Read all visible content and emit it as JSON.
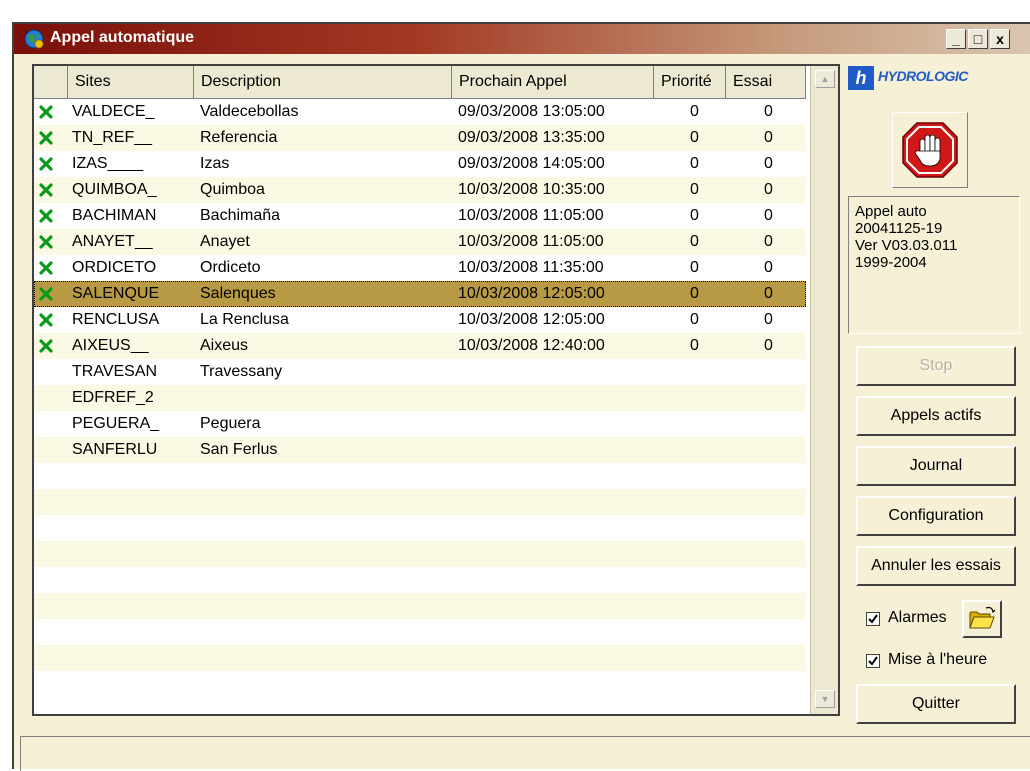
{
  "window": {
    "title": "Appel automatique",
    "minimize_label": "_",
    "maximize_label": "□",
    "close_label": "x"
  },
  "grid": {
    "columns": [
      "Sites",
      "Description",
      "Prochain Appel",
      "Priorité",
      "Essai"
    ],
    "rows": [
      {
        "site": "VALDECE_",
        "description": "Valdecebollas",
        "next_call": "09/03/2008 13:05:00",
        "priority": "0",
        "attempt": "0",
        "status_icon": "green-x-icon"
      },
      {
        "site": "TN_REF__",
        "description": "Referencia",
        "next_call": "09/03/2008 13:35:00",
        "priority": "0",
        "attempt": "0",
        "status_icon": "green-x-icon"
      },
      {
        "site": "IZAS____",
        "description": "Izas",
        "next_call": "09/03/2008 14:05:00",
        "priority": "0",
        "attempt": "0",
        "status_icon": "green-x-icon"
      },
      {
        "site": "QUIMBOA_",
        "description": "Quimboa",
        "next_call": "10/03/2008 10:35:00",
        "priority": "0",
        "attempt": "0",
        "status_icon": "green-x-icon"
      },
      {
        "site": "BACHIMAN",
        "description": "Bachimaña",
        "next_call": "10/03/2008 11:05:00",
        "priority": "0",
        "attempt": "0",
        "status_icon": "green-x-icon"
      },
      {
        "site": "ANAYET__",
        "description": "Anayet",
        "next_call": "10/03/2008 11:05:00",
        "priority": "0",
        "attempt": "0",
        "status_icon": "green-x-icon"
      },
      {
        "site": "ORDICETO",
        "description": "Ordiceto",
        "next_call": "10/03/2008 11:35:00",
        "priority": "0",
        "attempt": "0",
        "status_icon": "green-x-icon"
      },
      {
        "site": "SALENQUE",
        "description": "Salenques",
        "next_call": "10/03/2008 12:05:00",
        "priority": "0",
        "attempt": "0",
        "status_icon": "green-x-icon"
      },
      {
        "site": "RENCLUSA",
        "description": "La Renclusa",
        "next_call": "10/03/2008 12:05:00",
        "priority": "0",
        "attempt": "0",
        "status_icon": "green-x-icon"
      },
      {
        "site": "AIXEUS__",
        "description": "Aixeus",
        "next_call": "10/03/2008 12:40:00",
        "priority": "0",
        "attempt": "0",
        "status_icon": "green-x-icon"
      },
      {
        "site": "TRAVESAN",
        "description": "Travessany",
        "next_call": "",
        "priority": "",
        "attempt": "",
        "status_icon": ""
      },
      {
        "site": "EDFREF_2",
        "description": "",
        "next_call": "",
        "priority": "",
        "attempt": "",
        "status_icon": ""
      },
      {
        "site": "PEGUERA_",
        "description": "Peguera",
        "next_call": "",
        "priority": "",
        "attempt": "",
        "status_icon": ""
      },
      {
        "site": "SANFERLU",
        "description": "San Ferlus",
        "next_call": "",
        "priority": "",
        "attempt": "",
        "status_icon": ""
      }
    ],
    "selected_row": 7
  },
  "sidebar": {
    "logo_mark": "h",
    "logo_text": "HYDROLOGIC",
    "stop_icon": "stop-hand-icon",
    "info_lines": [
      "Appel auto",
      "20041125-19",
      "Ver V03.03.011",
      "1999-2004"
    ],
    "buttons": {
      "stop": "Stop",
      "active_calls": "Appels actifs",
      "journal": "Journal",
      "configuration": "Configuration",
      "cancel_attempts": "Annuler les essais",
      "quit": "Quitter"
    },
    "alarms_label": "Alarmes",
    "alarms_checked": true,
    "time_sync_label": "Mise à l'heure",
    "time_sync_checked": true,
    "folder_icon": "open-folder-icon"
  },
  "colors": {
    "title_start": "#7a0f0a",
    "selection": "#b89a45",
    "row_alt": "#fbf8e3",
    "window_bg": "#f6f0d6",
    "logo_blue": "#1f5cc8"
  }
}
